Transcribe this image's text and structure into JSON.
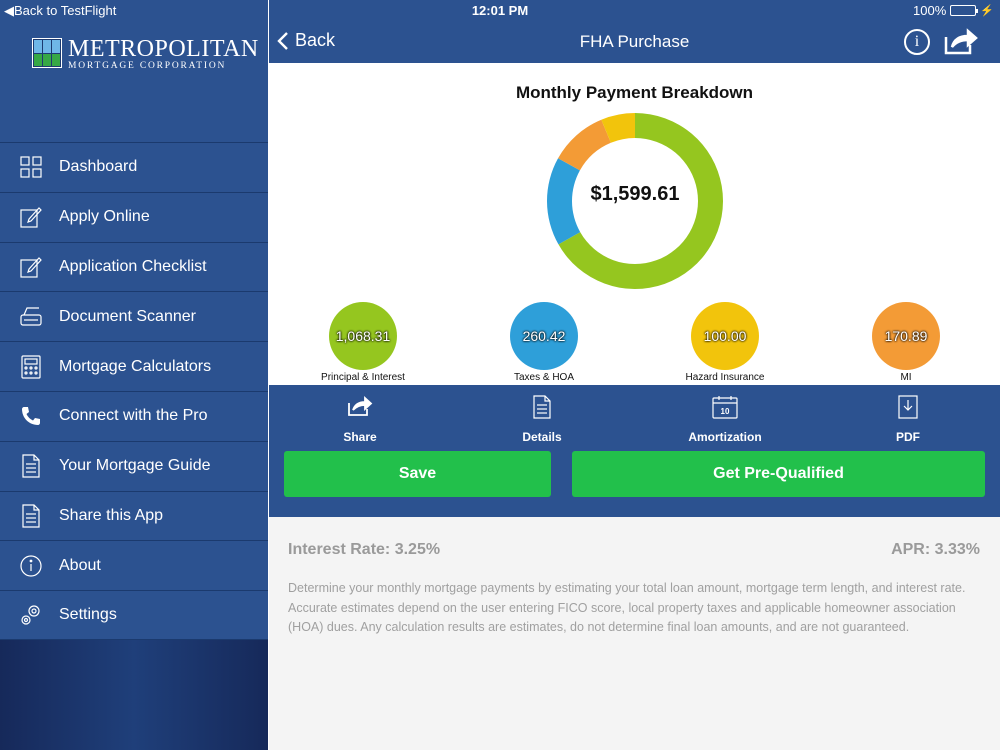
{
  "status_bar": {
    "back_label": "Back to TestFlight",
    "time": "12:01 PM",
    "battery": "100%"
  },
  "brand": {
    "name": "Metropolitan",
    "subtitle": "MORTGAGE CORPORATION"
  },
  "sidebar": {
    "items": [
      {
        "label": "Dashboard",
        "icon": "grid-icon"
      },
      {
        "label": "Apply Online",
        "icon": "edit-icon"
      },
      {
        "label": "Application Checklist",
        "icon": "edit-icon"
      },
      {
        "label": "Document Scanner",
        "icon": "scanner-icon"
      },
      {
        "label": "Mortgage Calculators",
        "icon": "calculator-icon"
      },
      {
        "label": "Connect with the Pro",
        "icon": "phone-icon"
      },
      {
        "label": "Your Mortgage Guide",
        "icon": "document-icon"
      },
      {
        "label": "Share this App",
        "icon": "document-icon"
      },
      {
        "label": "About",
        "icon": "info-icon"
      },
      {
        "label": "Settings",
        "icon": "gear-icon"
      }
    ]
  },
  "nav": {
    "back_label": "Back",
    "title": "FHA Purchase"
  },
  "breakdown": {
    "title": "Monthly Payment Breakdown",
    "total": "$1,599.61",
    "items": [
      {
        "value": "1,068.31",
        "label": "Principal & Interest",
        "color": "#95c61f"
      },
      {
        "value": "260.42",
        "label": "Taxes & HOA",
        "color": "#2e9fd9"
      },
      {
        "value": "100.00",
        "label": "Hazard Insurance",
        "color": "#f2c40c"
      },
      {
        "value": "170.89",
        "label": "MI",
        "color": "#f39b36"
      }
    ]
  },
  "actions": {
    "share": "Share",
    "details": "Details",
    "amortization": "Amortization",
    "pdf": "PDF",
    "calendar_day": "10"
  },
  "buttons": {
    "save": "Save",
    "prequalify": "Get Pre-Qualified"
  },
  "info": {
    "rate": "Interest Rate: 3.25%",
    "apr": "APR: 3.33%",
    "description": "Determine your monthly mortgage payments by estimating your total loan amount, mortgage term length, and interest rate. Accurate estimates depend on the user entering FICO score, local property taxes and applicable homeowner association (HOA) dues. Any calculation results are estimates, do not determine final loan amounts, and are not guaranteed."
  }
}
